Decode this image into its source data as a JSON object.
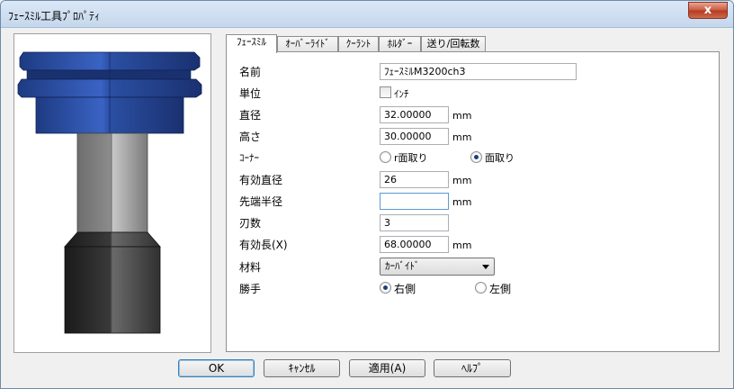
{
  "window": {
    "title": "ﾌｪｰｽﾐﾙ工具ﾌﾟﾛﾊﾟﾃｨ",
    "close_label": "x"
  },
  "tabs": [
    {
      "label": "ﾌｪｰｽﾐﾙ",
      "active": true
    },
    {
      "label": "ｵｰﾊﾞｰﾗｲﾄﾞ",
      "active": false
    },
    {
      "label": "ｸｰﾗﾝﾄ",
      "active": false
    },
    {
      "label": "ﾎﾙﾀﾞｰ",
      "active": false
    },
    {
      "label": "送り/回転数",
      "active": false
    }
  ],
  "form": {
    "name_label": "名前",
    "name_value": "ﾌｪｰｽﾐﾙM3200ch3",
    "unit_label": "単位",
    "inch_label": "ｲﾝﾁ",
    "inch_checked": false,
    "diameter_label": "直径",
    "diameter_value": "32.00000",
    "height_label": "高さ",
    "height_value": "30.00000",
    "corner_label": "ｺｰﾅｰ",
    "corner_option_r": "r面取り",
    "corner_option_chamfer": "面取り",
    "corner_selected": "chamfer",
    "eff_diameter_label": "有効直径",
    "eff_diameter_value": "26",
    "tip_radius_label": "先端半径",
    "tip_radius_value": "",
    "flutes_label": "刃数",
    "flutes_value": "3",
    "eff_length_label": "有効長(X)",
    "eff_length_value": "68.00000",
    "material_label": "材料",
    "material_value": "ｶｰﾊﾞｲﾄﾞ",
    "hand_label": "勝手",
    "hand_right": "右側",
    "hand_left": "左側",
    "hand_selected": "right",
    "unit_mm": "mm"
  },
  "buttons": {
    "ok": "OK",
    "cancel": "ｷｬﾝｾﾙ",
    "apply": "適用(A)",
    "help": "ﾍﾙﾌﾟ"
  },
  "colors": {
    "holder_blue": "#2c4f9e",
    "shank_gray": "#9a9a9a",
    "base_dark": "#3a3a3a"
  }
}
